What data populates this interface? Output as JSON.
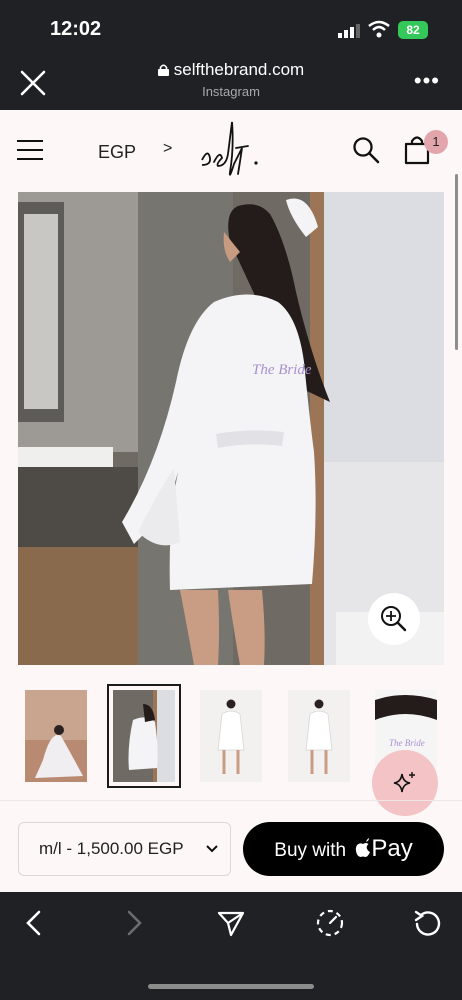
{
  "status_bar": {
    "time": "12:02",
    "battery": "82"
  },
  "browser": {
    "domain": "selfthebrand.com",
    "source": "Instagram"
  },
  "header": {
    "currency": "EGP",
    "brand": "self.",
    "cart_count": "1"
  },
  "product": {
    "embroidery_text": "The Bride"
  },
  "purchase": {
    "variant": "m/l - 1,500.00 EGP",
    "pay_prefix": "Buy with",
    "pay_mark": "Pay"
  },
  "icons": [
    "close-icon",
    "lock-icon",
    "more-icon",
    "menu-icon",
    "chevron-right-icon",
    "search-icon",
    "bag-icon",
    "zoom-icon",
    "sparkle-icon",
    "chevron-down-icon",
    "apple-icon",
    "back-icon",
    "forward-icon",
    "share-icon",
    "loading-icon",
    "reload-icon"
  ],
  "colors": {
    "accent_pink": "#f4c3c5",
    "badge_pink": "#e3a5ac",
    "page_bg": "#fdf8f7",
    "chrome_bg": "#1f2124",
    "battery_green": "#34c759"
  }
}
